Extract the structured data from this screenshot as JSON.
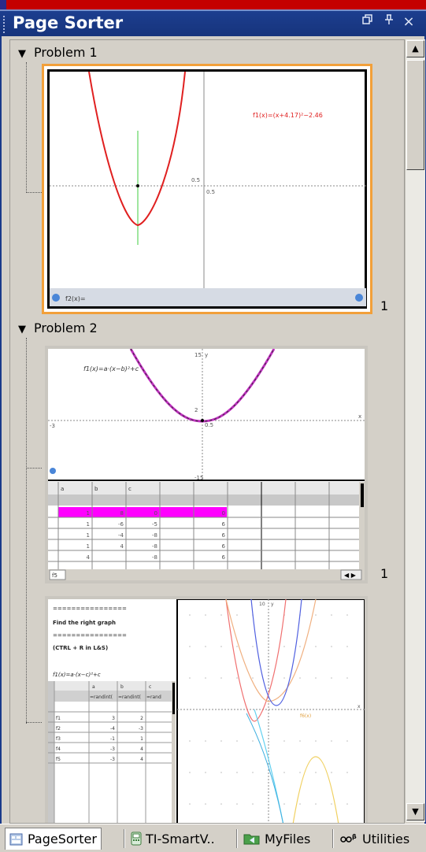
{
  "window": {
    "title": "Page Sorter",
    "buttons": {
      "restore": "🗗",
      "pin": "ᵖ",
      "close": "×"
    }
  },
  "problems": [
    {
      "label": "Problem 1",
      "pages": [
        {
          "number": "1"
        }
      ]
    },
    {
      "label": "Problem 2",
      "pages": [
        {
          "number": "1"
        }
      ]
    }
  ],
  "thumb1": {
    "equation": "f1(x)=(x+4.17)²−2.46",
    "x_tick": "0.5",
    "y_tick": "0.5",
    "entry_label": "f2(x)="
  },
  "thumb2": {
    "equation": "f1(x)=a·(x−b)²+c",
    "y_max": "15",
    "y_min": "-15",
    "x_min": "-3",
    "x_label": "x",
    "x_tick": "0.5",
    "y_tick": "2",
    "y_label": "y",
    "col_labels": [
      "a",
      "b",
      "c",
      "",
      "",
      "",
      "",
      ""
    ],
    "rows": [
      [
        "1",
        "8",
        "0",
        "",
        "0"
      ],
      [
        "1",
        "-6",
        "-5",
        "",
        "6"
      ],
      [
        "1",
        "-4",
        "-8",
        "",
        "6"
      ],
      [
        "1",
        "4",
        "-8",
        "",
        "6"
      ],
      [
        "4",
        "",
        "-8",
        "",
        "6"
      ]
    ],
    "tab_label": "f5"
  },
  "thumb3": {
    "lines": [
      "================",
      "Find the right graph",
      "================",
      "(CTRL + R in L&S)",
      "f1(x)=a·(x−c)²+c"
    ],
    "col_labels": [
      "",
      "a",
      "b",
      "c"
    ],
    "formula_row": [
      "",
      "=randint(",
      "=randint(",
      "=rand"
    ],
    "row_labels": [
      "f1",
      "f2",
      "f3",
      "f4",
      "f5"
    ],
    "rows": [
      [
        "3",
        "2",
        ""
      ],
      [
        "-4",
        "-3",
        ""
      ],
      [
        "-1",
        "1",
        ""
      ],
      [
        "-3",
        "4",
        ""
      ],
      [
        "-3",
        "4",
        ""
      ]
    ],
    "graph_label": "f6(x)",
    "x_label": "x",
    "y_max": "10",
    "y_label": "y"
  },
  "tabs": [
    {
      "label": "PageSorter",
      "icon": "page-sorter-icon",
      "selected": true
    },
    {
      "label": "TI-SmartV..",
      "icon": "calculator-icon",
      "selected": false
    },
    {
      "label": "MyFiles",
      "icon": "folder-icon",
      "selected": false
    },
    {
      "label": "Utilities",
      "icon": "utilities-icon",
      "selected": false
    }
  ]
}
